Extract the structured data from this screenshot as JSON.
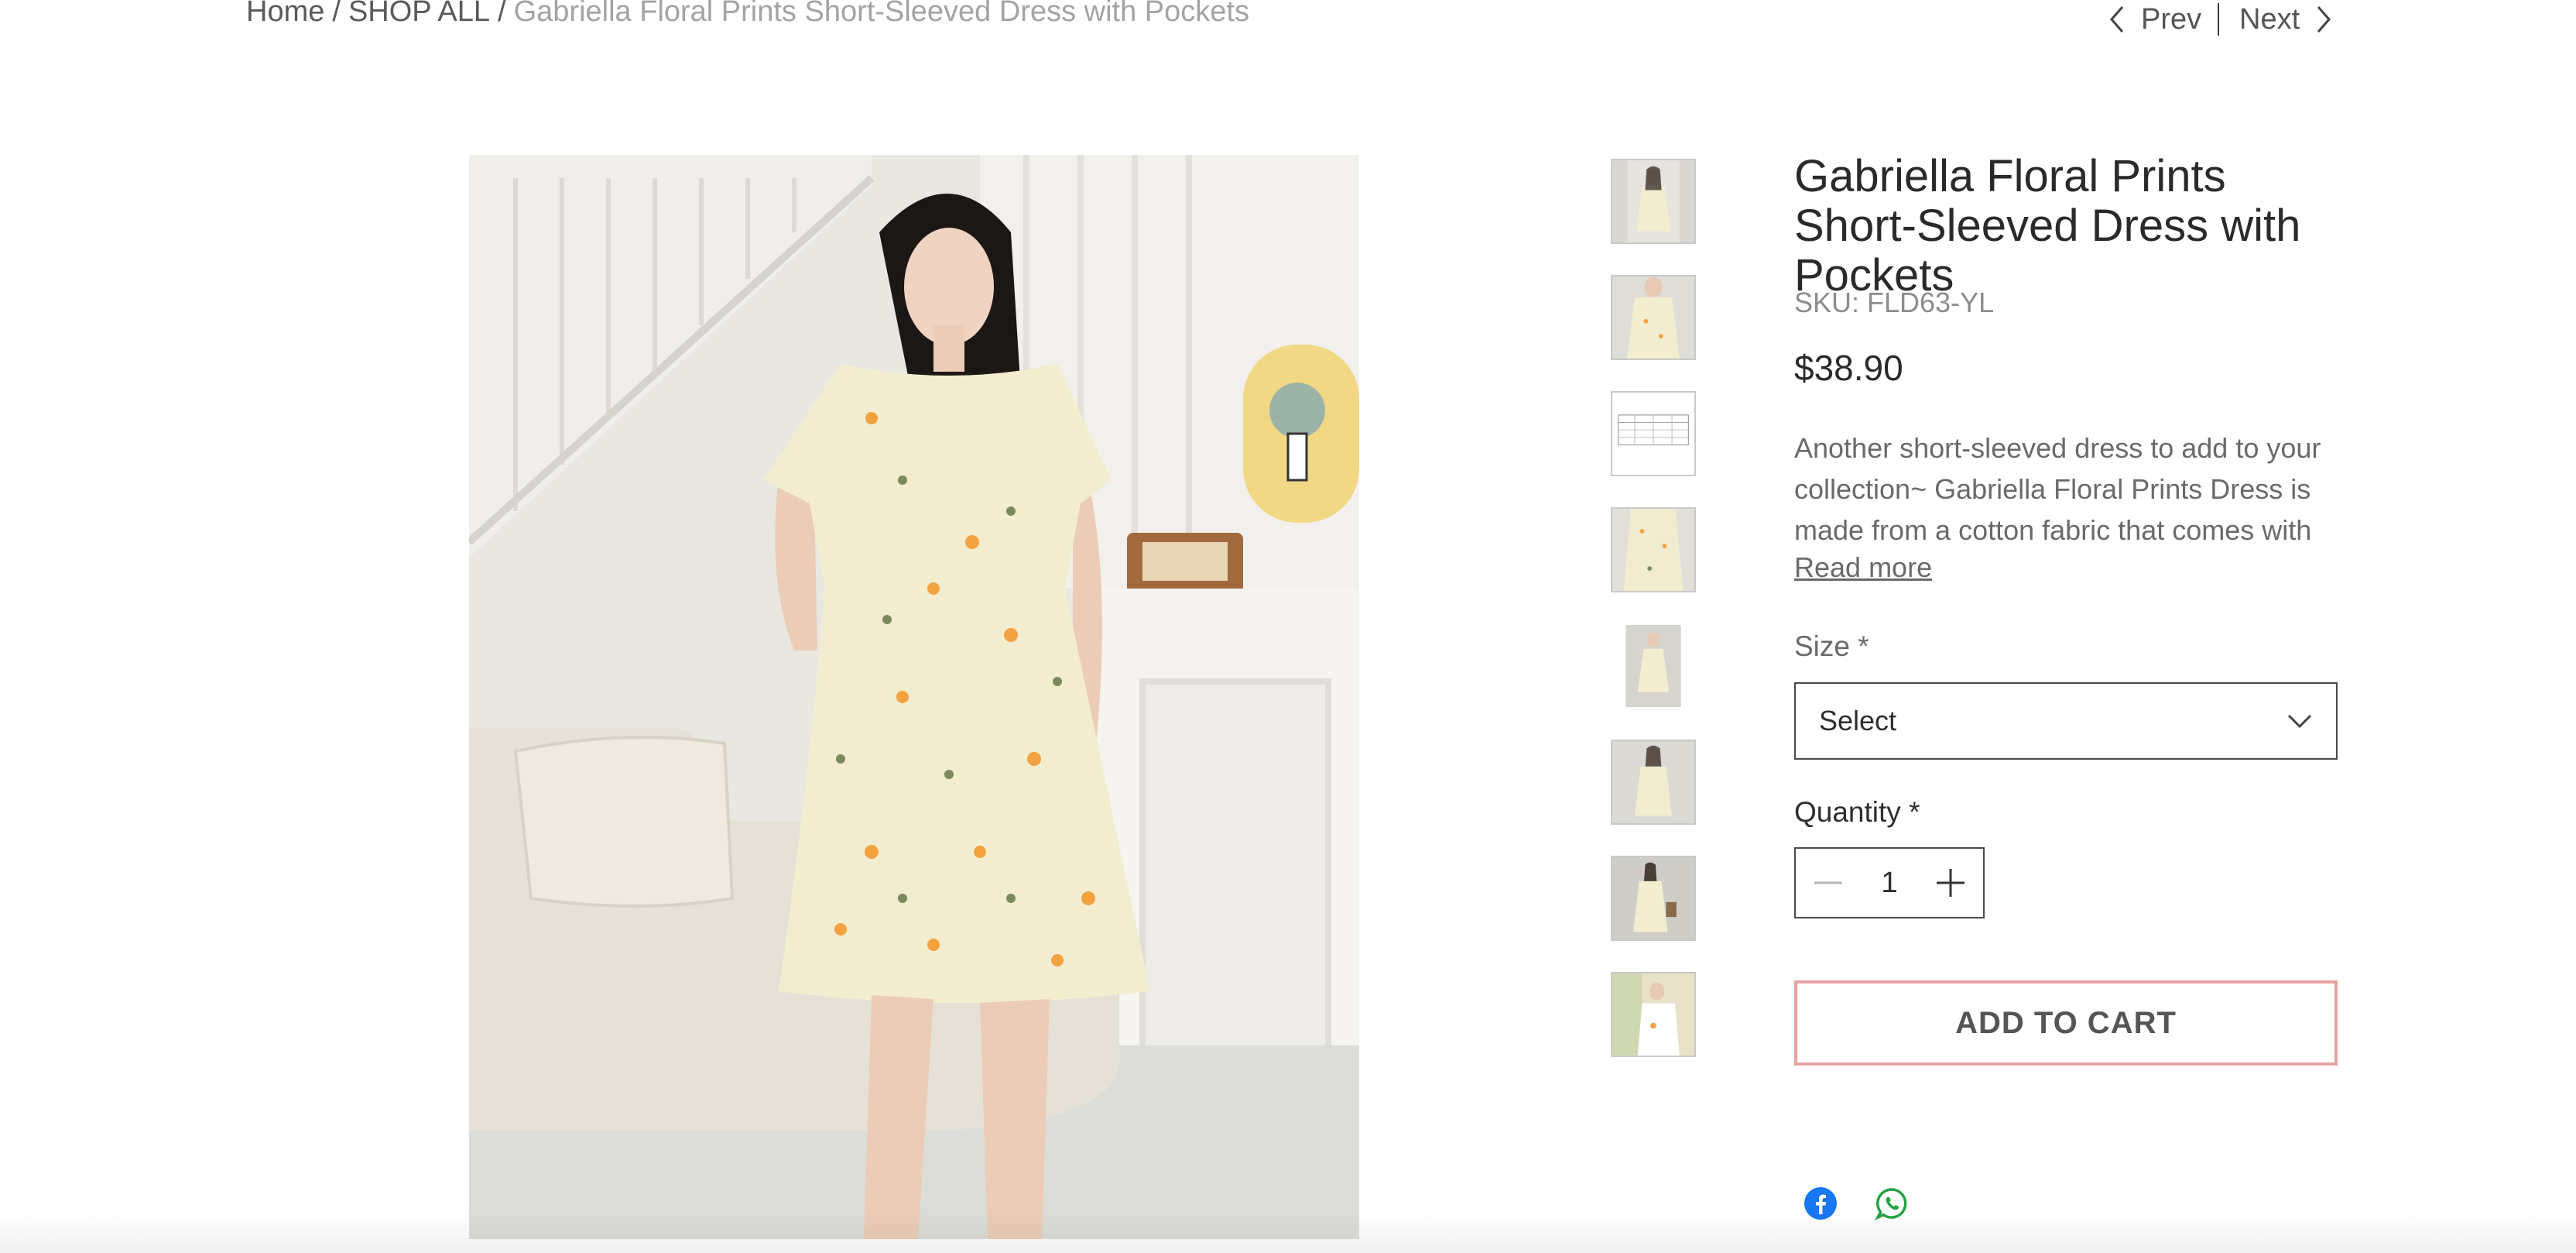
{
  "breadcrumb": {
    "home": "Home",
    "shop_all": "SHOP ALL",
    "current": "Gabriella Floral Prints Short-Sleeved Dress with Pockets",
    "separator": "/"
  },
  "pager": {
    "prev": "Prev",
    "next": "Next"
  },
  "product": {
    "title": "Gabriella Floral Prints Short-Sleeved Dress with Pockets",
    "sku": "SKU: FLD63-YL",
    "price": "$38.90",
    "description": "Another short-sleeved dress to add to your collection~ Gabriella Floral Prints Dress is made from a cotton fabric that comes with",
    "read_more": "Read more"
  },
  "options": {
    "size_label": "Size *",
    "size_value": "Select",
    "quantity_label": "Quantity *",
    "quantity_value": "1"
  },
  "cart": {
    "add_label": "ADD TO CART"
  },
  "colors": {
    "accent_border": "#e4a3a0",
    "facebook": "#1877f2",
    "whatsapp": "#25a244",
    "dress": "#f3edd0"
  },
  "icons": [
    "chevron-left-icon",
    "chevron-right-icon",
    "chevron-down-icon",
    "minus-icon",
    "plus-icon",
    "facebook-icon",
    "whatsapp-icon"
  ]
}
